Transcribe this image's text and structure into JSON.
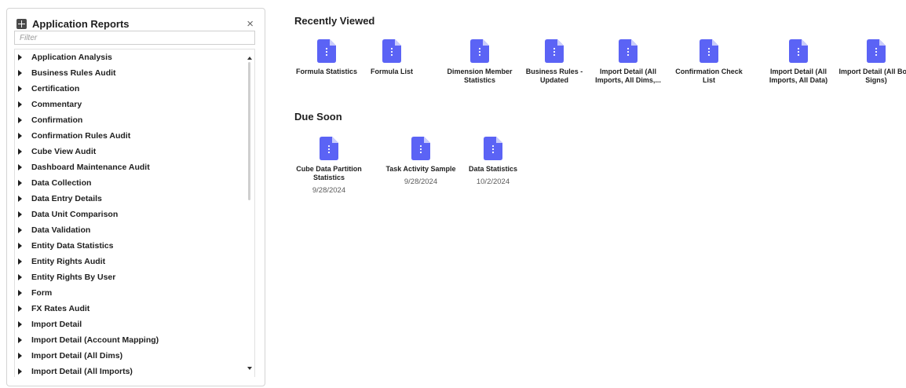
{
  "panel": {
    "title": "Application Reports",
    "header_icon": "grid-icon",
    "close_glyph": "×",
    "filter_placeholder": "Filter",
    "items": [
      {
        "label": "Application Analysis"
      },
      {
        "label": "Business Rules Audit"
      },
      {
        "label": "Certification"
      },
      {
        "label": "Commentary"
      },
      {
        "label": "Confirmation"
      },
      {
        "label": "Confirmation Rules Audit"
      },
      {
        "label": "Cube View Audit"
      },
      {
        "label": "Dashboard Maintenance Audit"
      },
      {
        "label": "Data Collection"
      },
      {
        "label": "Data Entry Details"
      },
      {
        "label": "Data Unit Comparison"
      },
      {
        "label": "Data Validation"
      },
      {
        "label": "Entity Data Statistics"
      },
      {
        "label": "Entity Rights Audit"
      },
      {
        "label": "Entity Rights By User"
      },
      {
        "label": "Form"
      },
      {
        "label": "FX Rates Audit"
      },
      {
        "label": "Import Detail"
      },
      {
        "label": "Import Detail (Account Mapping)"
      },
      {
        "label": "Import Detail (All Dims)"
      },
      {
        "label": "Import Detail (All Imports)"
      }
    ]
  },
  "recently_viewed": {
    "title": "Recently Viewed",
    "items": [
      {
        "label": "Formula Statistics"
      },
      {
        "label": "Formula List"
      },
      {
        "label": "Dimension Member Statistics"
      },
      {
        "label": "Business Rules - Updated"
      },
      {
        "label": "Import Detail (All Imports, All Dims,..."
      },
      {
        "label": "Confirmation Check List"
      },
      {
        "label": "Import Detail (All Imports, All Data)"
      },
      {
        "label": "Import Detail (All Both Signs)"
      }
    ]
  },
  "due_soon": {
    "title": "Due Soon",
    "items": [
      {
        "label": "Cube Data Partition Statistics",
        "date": "9/28/2024"
      },
      {
        "label": "Task Activity Sample",
        "date": "9/28/2024"
      },
      {
        "label": "Data Statistics",
        "date": "10/2/2024"
      }
    ]
  },
  "colors": {
    "doc_icon": "#5b63f5",
    "doc_fold": "#c9ccfc"
  }
}
